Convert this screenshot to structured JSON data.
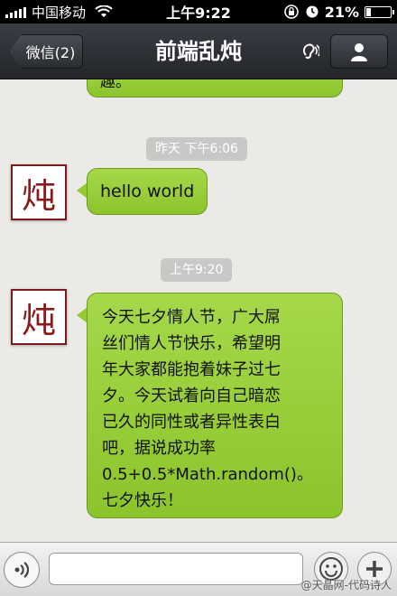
{
  "status_bar": {
    "carrier": "中国移动",
    "time": "上午9:22",
    "battery": "21%",
    "battery_level": 0.21
  },
  "nav": {
    "back_label": "微信(2)",
    "title": "前端乱炖"
  },
  "chat": {
    "previous_message_tail": "趣。",
    "messages": [
      {
        "timestamp": "昨天 下午6:06",
        "avatar_char": "炖",
        "text": "hello world"
      },
      {
        "timestamp": "上午9:20",
        "avatar_char": "炖",
        "lines": [
          "今天七夕情人节，广大屌",
          "丝们情人节快乐，希望明",
          "年大家都能抱着妹子过七",
          "夕。今天试着向自己暗恋",
          "已久的同性或者异性表白",
          "吧，据说成功率",
          "0.5+0.5*Math.random()。",
          "七夕快乐！"
        ]
      }
    ]
  },
  "input_bar": {
    "placeholder": "",
    "value": ""
  },
  "watermark": "@天晶网-代码诗人",
  "colors": {
    "bubble": "#9ccd3a",
    "avatar_border": "#7a1a1a",
    "nav_bg": "#2e3036"
  }
}
